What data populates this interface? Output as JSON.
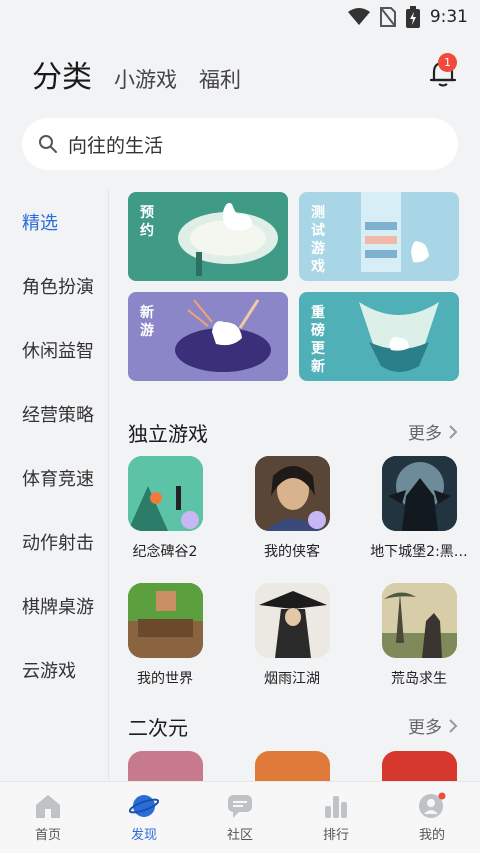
{
  "status": {
    "time": "9:31"
  },
  "topnav": {
    "main": "分类",
    "tabs": [
      "小游戏",
      "福利"
    ],
    "bell_badge": "1"
  },
  "search": {
    "placeholder": "向往的生活"
  },
  "sidebar": {
    "items": [
      "精选",
      "角色扮演",
      "休闲益智",
      "经营策略",
      "体育竞速",
      "动作射击",
      "棋牌桌游",
      "云游戏"
    ],
    "active_index": 0
  },
  "banners": [
    {
      "label": "预约"
    },
    {
      "label": "测试游戏"
    },
    {
      "label": "新游"
    },
    {
      "label": "重磅更新"
    }
  ],
  "sections": [
    {
      "title": "独立游戏",
      "more": "更多",
      "games": [
        "纪念碑谷2",
        "我的侠客",
        "地下城堡2:黑…",
        "我的世界",
        "烟雨江湖",
        "荒岛求生"
      ]
    },
    {
      "title": "二次元",
      "more": "更多"
    }
  ],
  "tabbar": {
    "items": [
      "首页",
      "发现",
      "社区",
      "排行",
      "我的"
    ],
    "active_index": 1
  },
  "colors": {
    "accent": "#2a6dd8",
    "badge": "#f04a3a"
  }
}
